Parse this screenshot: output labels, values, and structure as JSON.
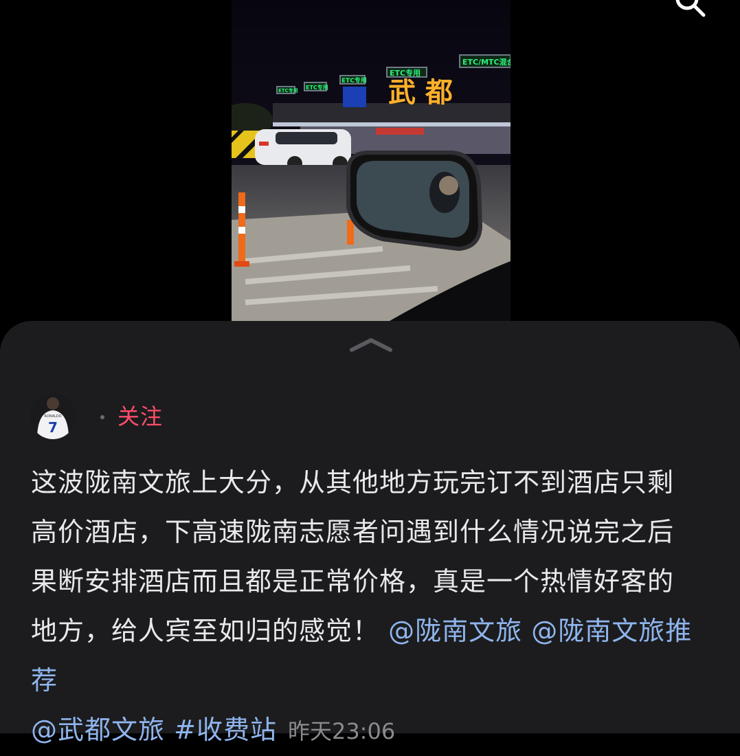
{
  "header": {
    "search_icon": "search-icon"
  },
  "post": {
    "follow_label": "关注",
    "text_lines": [
      "这波陇南文旅上大分，从其他地方玩完订不到酒店只剩",
      "高价酒店，下高速陇南志愿者问遇到什么情况说完之后",
      "果断安排酒店而且都是正常价格，真是一个热情好客的",
      "地方，给人宾至如归的感觉！"
    ],
    "mentions": [
      "@陇南文旅",
      "@陇南文旅推荐",
      "@武都文旅"
    ],
    "hashtag": "#收费站",
    "timestamp": "昨天23:06"
  },
  "photo": {
    "signs": [
      "ETC专用",
      "ETC专用",
      "ETC专用",
      "ETC专用",
      "ETC/MTC混合"
    ],
    "station_name": "武 都",
    "avatar_jersey_name": "RONALDO",
    "avatar_jersey_number": "7"
  },
  "colors": {
    "follow": "#ff4d6a",
    "tag": "#8fb5ee",
    "sheet": "#1c1c1e"
  }
}
